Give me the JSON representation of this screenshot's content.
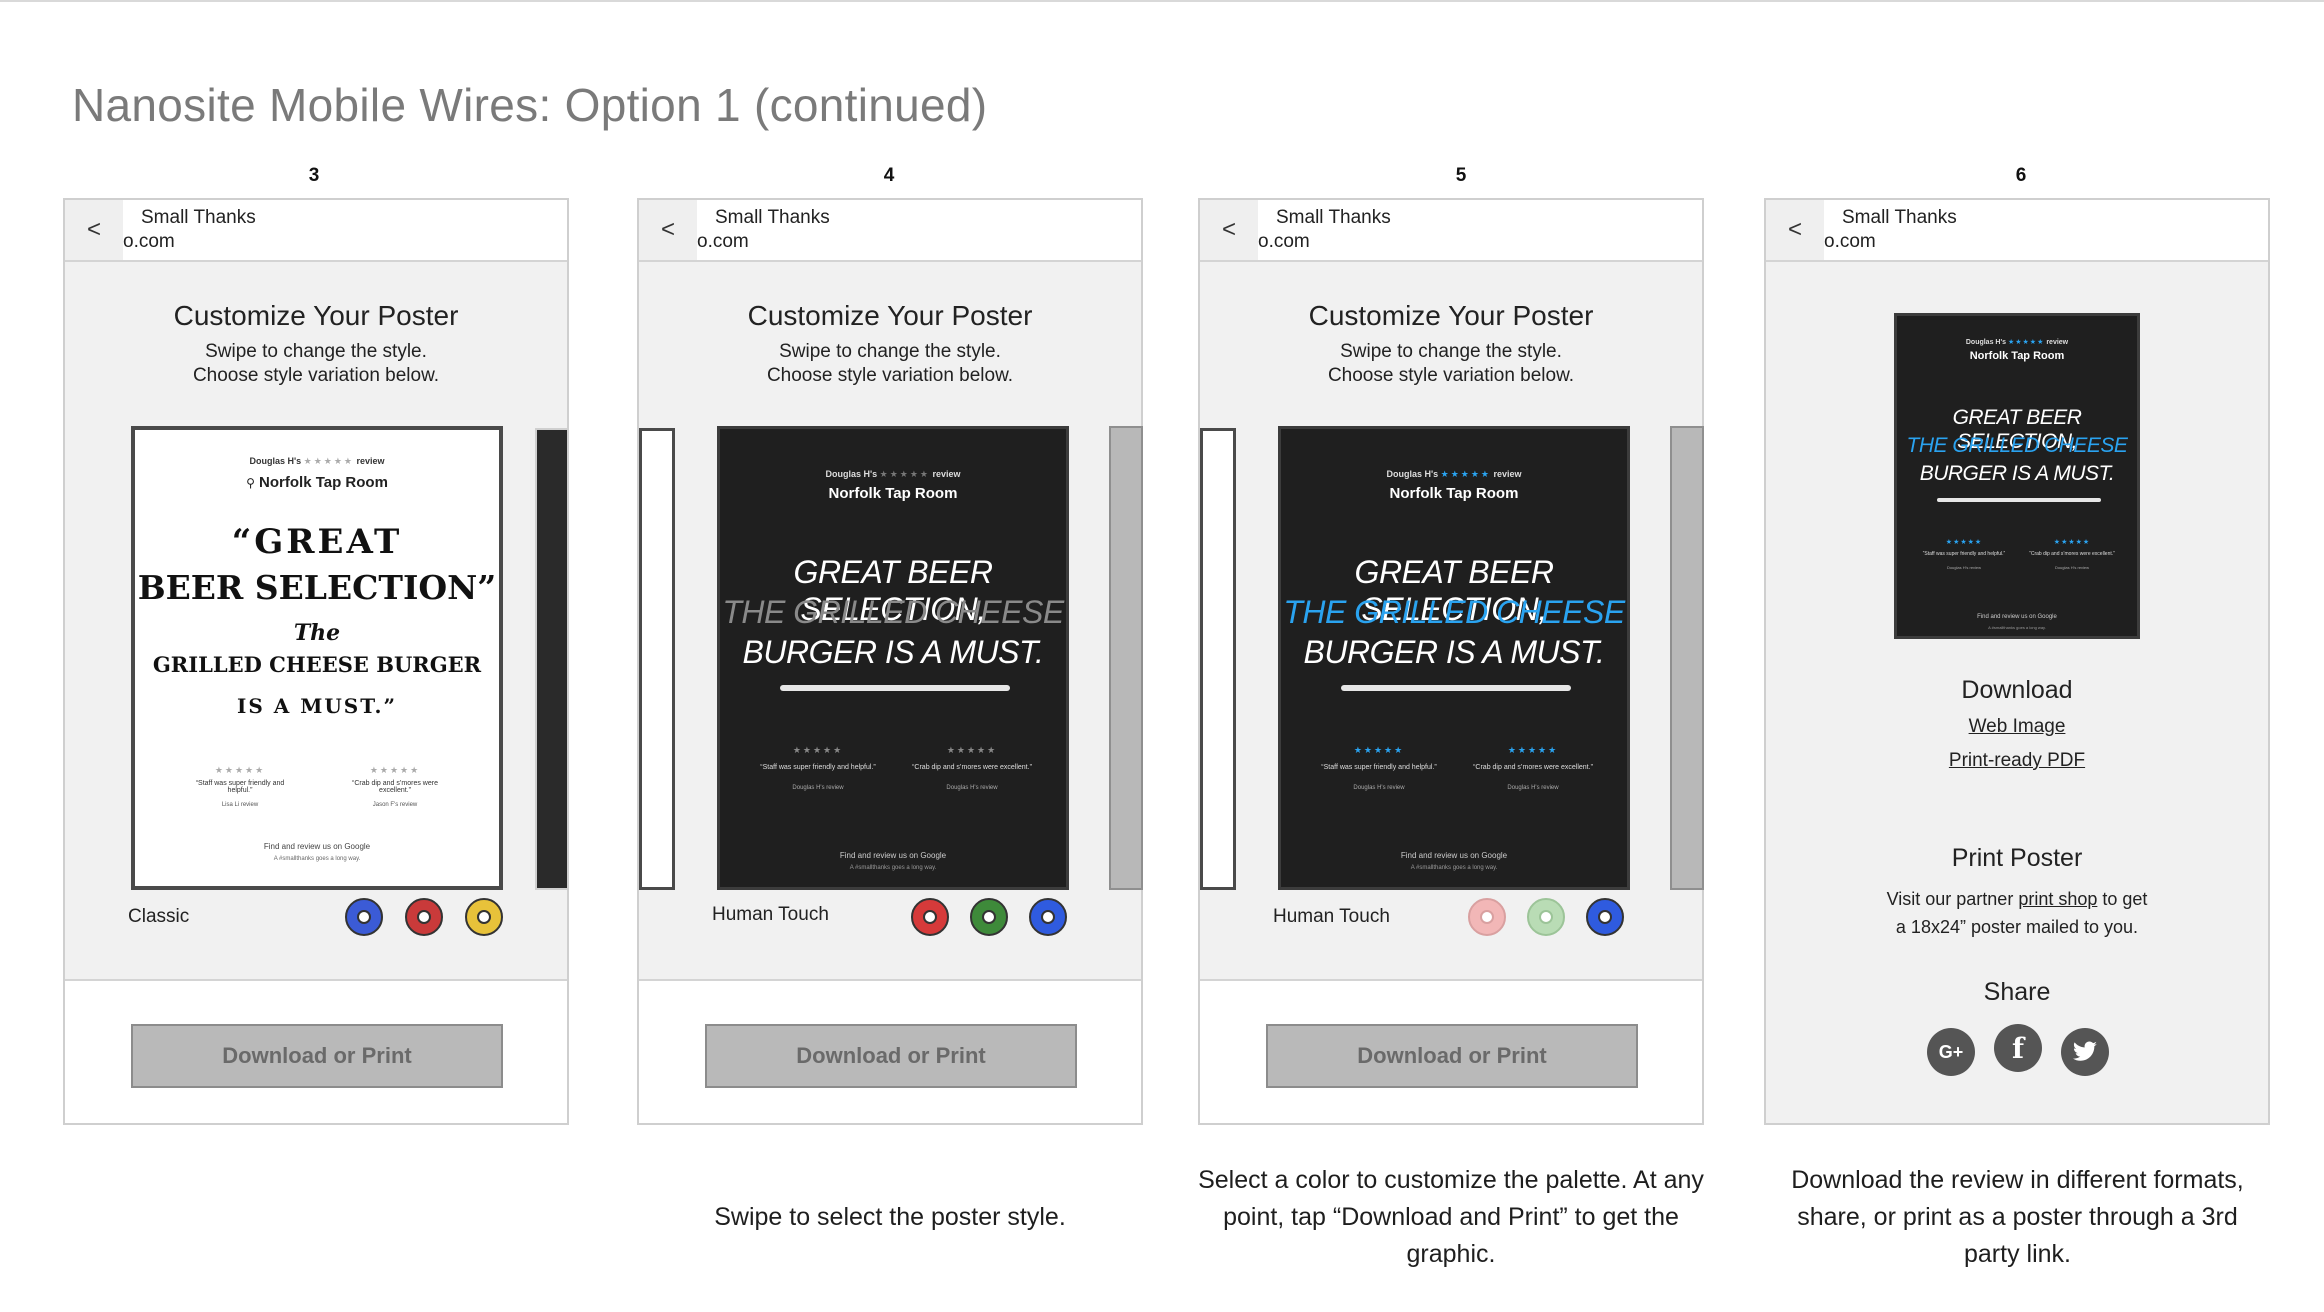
{
  "page": {
    "title": "Nanosite Mobile Wires: Option 1 (continued)"
  },
  "common": {
    "back": "<",
    "site_line1": "Small Thanks",
    "site_line2": "o.com",
    "customize_title": "Customize Your Poster",
    "customize_sub1": "Swipe to change the style.",
    "customize_sub2": "Choose style variation below.",
    "cta": "Download or Print",
    "poster": {
      "reviewer": "Douglas H's",
      "review_word": "review",
      "venue": "Norfolk Tap Room",
      "quote_lines": [
        "GREAT BEER SELECTION,",
        "THE GRILLED CHEESE",
        "BURGER IS A MUST."
      ],
      "sub_quote_left": "“Staff was super friendly and helpful.”",
      "sub_quote_right": "“Crab dip and s’mores were excellent.”",
      "sub_author_left": "Douglas H's review",
      "sub_author_right": "Douglas H's review",
      "footer": "Find and review us on Google",
      "tagline": "A #smallthanks goes a long way."
    },
    "classic_poster": {
      "words": [
        "“GREAT",
        "BEER SELECTION”",
        "The",
        "GRILLED CHEESE BURGER",
        "IS A MUST.”"
      ],
      "sub_author_left": "Lisa Li review",
      "sub_author_right": "Jason F's review"
    },
    "stars": "★★★★★"
  },
  "steps": [
    {
      "number": "3",
      "style_label": "Classic",
      "swatches": [
        "#3b5bd6",
        "#c93a3a",
        "#e8c23a"
      ],
      "caption": ""
    },
    {
      "number": "4",
      "style_label": "Human Touch",
      "swatches": [
        "#d63a3a",
        "#3e8a3a",
        "#2f5bdf"
      ],
      "caption": "Swipe to select the poster style."
    },
    {
      "number": "5",
      "style_label": "Human Touch",
      "swatches": [
        "#f2b7b7",
        "#b9dcb5",
        "#2f5bdf"
      ],
      "caption": "Select a color to customize the palette. At any point, tap “Download and Print” to get the graphic."
    },
    {
      "number": "6",
      "style_label": "",
      "swatches": [],
      "caption": "Download the review in different formats, share, or print as a poster through a 3rd party link."
    }
  ],
  "final": {
    "download_title": "Download",
    "web_image": "Web Image",
    "print_pdf": "Print-ready PDF",
    "print_title": "Print Poster",
    "print_text_a": "Visit our partner ",
    "print_link": "print shop",
    "print_text_b": " to get",
    "print_text_c": "a 18x24” poster mailed to you.",
    "share_title": "Share",
    "share_icons": [
      "google-plus-icon",
      "facebook-icon",
      "twitter-icon"
    ]
  },
  "colors": {
    "accent_blue": "#2aa3f0",
    "frame_border": "#cfcfcf",
    "cta_gray": "#b9b9b9"
  }
}
